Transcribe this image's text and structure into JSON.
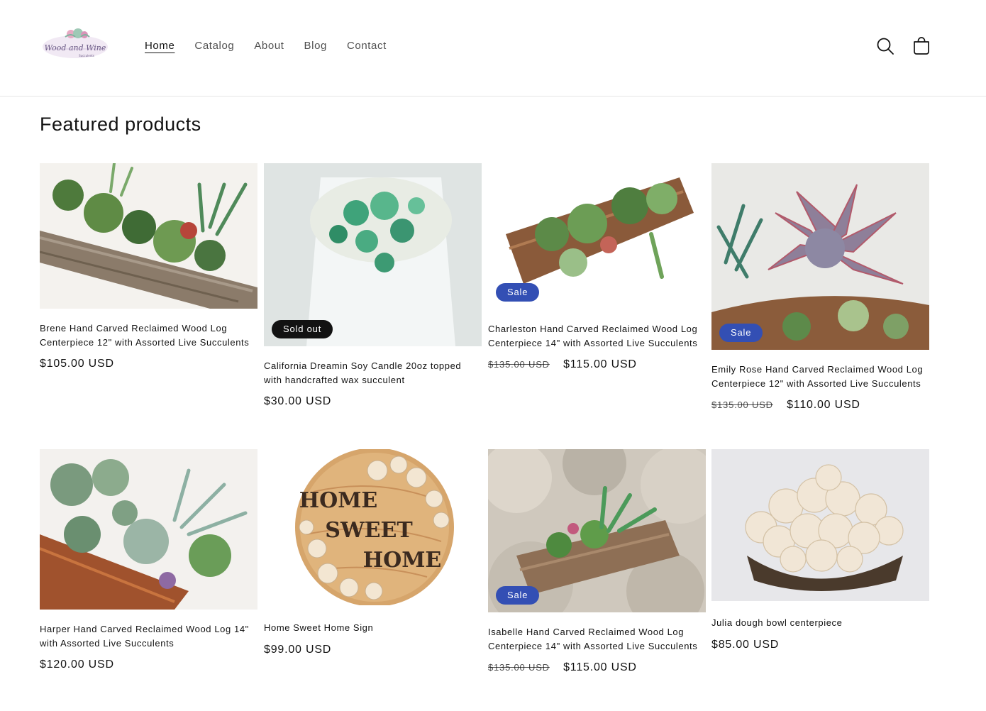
{
  "header": {
    "logo_text": "Wood and Wine",
    "logo_subtext": "Succulents",
    "nav": [
      {
        "label": "Home",
        "active": true
      },
      {
        "label": "Catalog",
        "active": false
      },
      {
        "label": "About",
        "active": false
      },
      {
        "label": "Blog",
        "active": false
      },
      {
        "label": "Contact",
        "active": false
      }
    ],
    "icons": [
      "search-icon",
      "cart-icon"
    ]
  },
  "section": {
    "title": "Featured products"
  },
  "products": [
    {
      "title": "Brene Hand Carved Reclaimed Wood Log Centerpiece 12\" with Assorted Live Succulents",
      "price": "$105.00 USD",
      "compare_price": "",
      "badge": ""
    },
    {
      "title": "California Dreamin Soy Candle 20oz topped with handcrafted wax succulent",
      "price": "$30.00 USD",
      "compare_price": "",
      "badge": "Sold out"
    },
    {
      "title": "Charleston Hand Carved Reclaimed Wood Log Centerpiece 14\" with Assorted Live Succulents",
      "price": "$115.00 USD",
      "compare_price": "$135.00 USD",
      "badge": "Sale"
    },
    {
      "title": "Emily Rose Hand Carved Reclaimed Wood Log Centerpiece 12\" with Assorted Live Succulents",
      "price": "$110.00 USD",
      "compare_price": "$135.00 USD",
      "badge": "Sale"
    },
    {
      "title": "Harper Hand Carved Reclaimed Wood Log 14\" with Assorted Live Succulents",
      "price": "$120.00 USD",
      "compare_price": "",
      "badge": ""
    },
    {
      "title": "Home Sweet Home Sign",
      "price": "$99.00 USD",
      "compare_price": "",
      "badge": "",
      "sign_text": [
        "HOME",
        "SWEET",
        "HOME"
      ]
    },
    {
      "title": "Isabelle Hand Carved Reclaimed Wood Log Centerpiece 14\" with Assorted Live Succulents",
      "price": "$115.00 USD",
      "compare_price": "$135.00 USD",
      "badge": "Sale"
    },
    {
      "title": "Julia dough bowl centerpiece",
      "price": "$85.00 USD",
      "compare_price": "",
      "badge": ""
    }
  ],
  "colors": {
    "sale_badge": "#334fb4",
    "sold_out_badge": "#121212",
    "text": "#121212"
  }
}
